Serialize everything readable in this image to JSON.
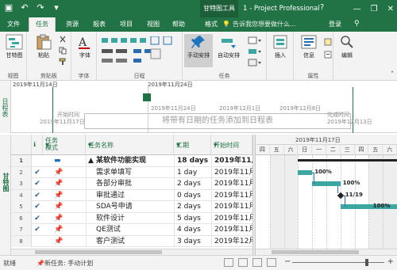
{
  "titlebar": {
    "tools_title": "甘特图工具",
    "app_title": "1 - Project Professional",
    "help": "?",
    "minimize": "—",
    "restore": "❐",
    "close": "✕"
  },
  "tabs": [
    {
      "label": "文件",
      "active": false
    },
    {
      "label": "任务",
      "active": true
    },
    {
      "label": "资源",
      "active": false
    },
    {
      "label": "报表",
      "active": false
    },
    {
      "label": "项目",
      "active": false
    },
    {
      "label": "视图",
      "active": false
    },
    {
      "label": "帮助",
      "active": false
    },
    {
      "label": "格式",
      "active": false
    }
  ],
  "tellme": "告诉我您想要做什么...",
  "signin": "登录",
  "ribbon": {
    "groups": [
      {
        "name": "视图",
        "buttons": [
          "甘特图"
        ]
      },
      {
        "name": "剪贴板",
        "buttons": [
          "粘贴"
        ]
      },
      {
        "name": "字体",
        "buttons": [
          "字体"
        ]
      },
      {
        "name": "日程",
        "buttons": []
      },
      {
        "name": "任务",
        "buttons": [
          "手动安排",
          "自动安排"
        ]
      },
      {
        "name": "插入",
        "buttons": [
          "插入"
        ]
      },
      {
        "name": "属性",
        "buttons": [
          "信息"
        ]
      },
      {
        "name": "",
        "buttons": [
          "编辑"
        ]
      }
    ]
  },
  "timeline": {
    "side_label": "日程表",
    "top_dates": [
      "2019年11月14日",
      "2019年11月24日"
    ],
    "scale_dates": [
      "2019年11月24日",
      "2019年12月1日",
      "2019年12月8日"
    ],
    "start_label": "开始时间",
    "start_date": "2019年11月17日",
    "finish_label": "完成时间",
    "finish_date": "2019年12月13日",
    "placeholder": "将带有日期的任务添加到日程表"
  },
  "main": {
    "side_label": "甘特图",
    "columns": {
      "info": "ℹ",
      "mode": "任务\n模式",
      "name": "任务名称",
      "duration": "工期",
      "start": "开始时间"
    },
    "rows": [
      {
        "num": "1",
        "check": "",
        "mode": "▬",
        "name": "▲ 某软件功能实现",
        "duration": "18 days",
        "start": "2019年11月1",
        "summary": true
      },
      {
        "num": "2",
        "check": "✔",
        "mode": "📌",
        "name": "需求单填写",
        "duration": "1 day",
        "start": "2019年11月1",
        "summary": false
      },
      {
        "num": "3",
        "check": "✔",
        "mode": "📌",
        "name": "各部分审批",
        "duration": "2 days",
        "start": "2019年11月1",
        "summary": false
      },
      {
        "num": "4",
        "check": "✔",
        "mode": "📌",
        "name": "审批通过",
        "duration": "0 days",
        "start": "2019年11月1",
        "summary": false
      },
      {
        "num": "5",
        "check": "✔",
        "mode": "📌",
        "name": "SDA号申请",
        "duration": "2 days",
        "start": "2019年11月2",
        "summary": false
      },
      {
        "num": "6",
        "check": "✔",
        "mode": "📌",
        "name": "软件设计",
        "duration": "5 days",
        "start": "2019年11月2",
        "summary": false
      },
      {
        "num": "7",
        "check": "✔",
        "mode": "📌",
        "name": "QE测试",
        "duration": "4 days",
        "start": "2019年11月2",
        "summary": false
      },
      {
        "num": "8",
        "check": "",
        "mode": "📌",
        "name": "客户测试",
        "duration": "3 days",
        "start": "2019年12月1",
        "summary": false
      }
    ]
  },
  "chart": {
    "week_label": "2019年11月17日",
    "days": [
      "四",
      "五",
      "六",
      "日",
      "一",
      "二",
      "三",
      "四",
      "五",
      "六"
    ],
    "bar_labels": [
      "100%",
      "100%",
      "11/19",
      "100%"
    ]
  },
  "statusbar": {
    "ready": "就绪",
    "new_task": "新任务: 手动计划"
  },
  "colors": {
    "brand": "#217346",
    "bar": "#3ba7a0",
    "link": "#2a6cb0"
  }
}
